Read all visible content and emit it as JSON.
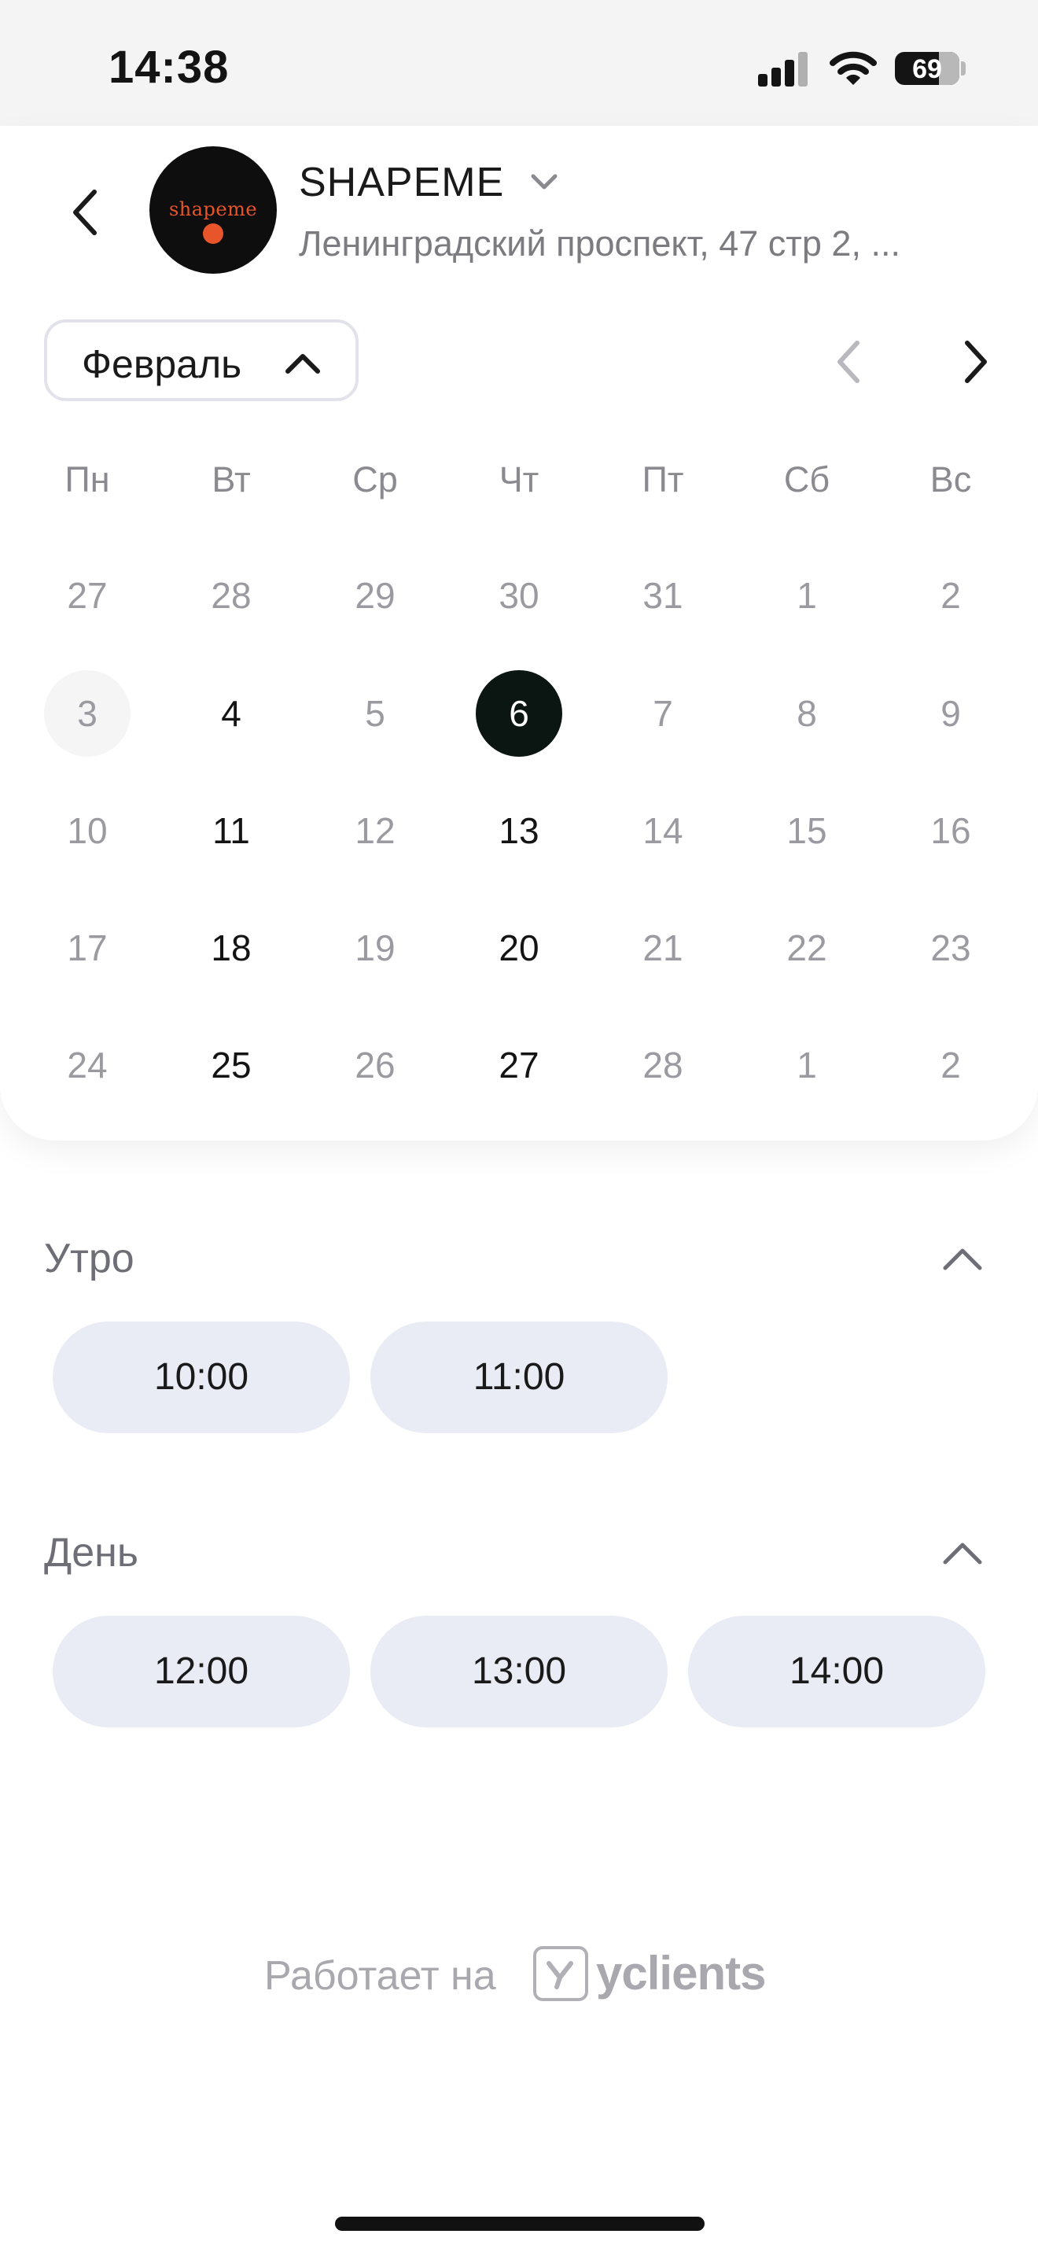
{
  "status_bar": {
    "time": "14:38",
    "battery": "69"
  },
  "header": {
    "company_name": "SHAPEME",
    "address": "Ленинградский проспект, 47 стр 2, ...",
    "logo_text": "shapeme"
  },
  "calendar": {
    "month": "Февраль",
    "weekdays": [
      "Пн",
      "Вт",
      "Ср",
      "Чт",
      "Пт",
      "Сб",
      "Вс"
    ],
    "weeks": [
      [
        "27",
        "28",
        "29",
        "30",
        "31",
        "1",
        "2"
      ],
      [
        "3",
        "4",
        "5",
        "6",
        "7",
        "8",
        "9"
      ],
      [
        "10",
        "11",
        "12",
        "13",
        "14",
        "15",
        "16"
      ],
      [
        "17",
        "18",
        "19",
        "20",
        "21",
        "22",
        "23"
      ],
      [
        "24",
        "25",
        "26",
        "27",
        "28",
        "1",
        "2"
      ]
    ],
    "selected_day": "6"
  },
  "sections": [
    {
      "title": "Утро",
      "slots": [
        "10:00",
        "11:00"
      ]
    },
    {
      "title": "День",
      "slots": [
        "12:00",
        "13:00",
        "14:00"
      ]
    }
  ],
  "footer": {
    "powered_by": "Работает на",
    "brand": "yclients"
  },
  "colors": {
    "selected": "#0b1512",
    "slot_bg": "#e9ecf4",
    "muted": "#9a9aa0"
  }
}
